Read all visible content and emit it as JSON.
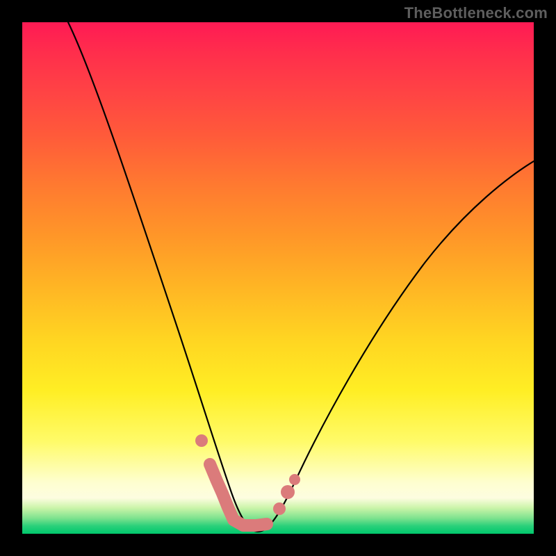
{
  "watermark": "TheBottleneck.com",
  "chart_data": {
    "type": "line",
    "title": "",
    "xlabel": "",
    "ylabel": "",
    "xlim": [
      0,
      100
    ],
    "ylim": [
      0,
      100
    ],
    "grid": false,
    "legend": false,
    "series": [
      {
        "name": "curve",
        "x": [
          9,
          12,
          15,
          18,
          21,
          24,
          27,
          30,
          33,
          35,
          37,
          39,
          40,
          41,
          42,
          43,
          45,
          47,
          49,
          51,
          53,
          56,
          60,
          64,
          68,
          72,
          76,
          80,
          84,
          88,
          92,
          96,
          100
        ],
        "y": [
          100,
          88,
          77,
          67,
          58,
          50,
          42,
          35,
          28,
          23,
          18,
          13,
          10,
          8,
          5,
          3,
          1,
          0.5,
          1,
          3,
          6,
          11,
          18,
          25,
          32,
          39,
          45,
          50.5,
          55.5,
          60,
          64,
          67.5,
          70.5
        ]
      }
    ],
    "highlight_points": {
      "x": [
        35,
        37,
        39,
        40,
        41,
        42,
        43,
        45,
        47,
        49,
        51,
        53
      ],
      "y": [
        23,
        18,
        13,
        10,
        8,
        5,
        3,
        1,
        0.5,
        1,
        3,
        6
      ]
    },
    "background_gradient_top_to_bottom": [
      "#ff1a54",
      "#ff7a30",
      "#ffee24",
      "#00c86c"
    ]
  }
}
